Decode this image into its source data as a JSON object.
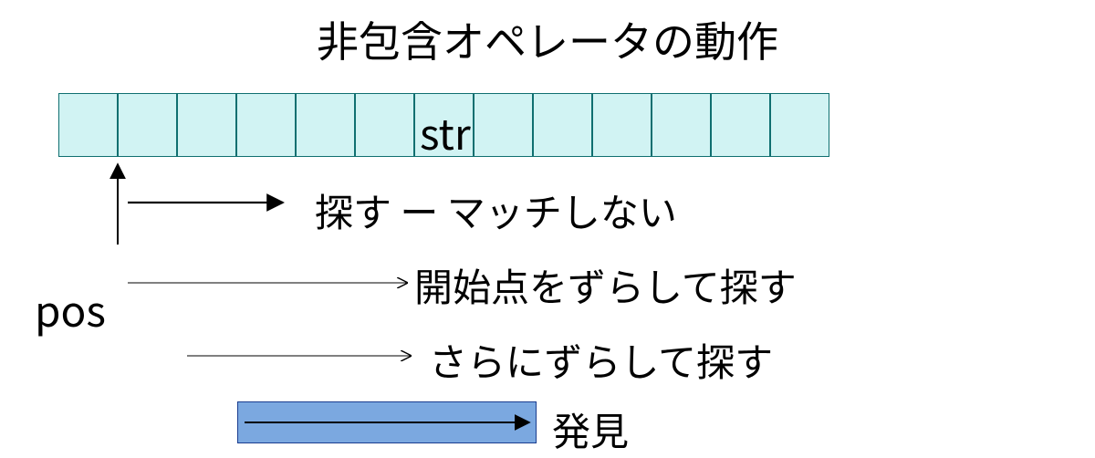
{
  "title": "非包含オペレータの動作",
  "array_label": "str",
  "pointer_label": "pos",
  "steps": {
    "search_nomatch": "探す ー マッチしない",
    "shift_search": "開始点をずらして探す",
    "further_shift": "さらにずらして探す",
    "found": "発見"
  },
  "cell_count": 13,
  "colors": {
    "cell_fill": "#d1f3f3",
    "cell_border": "#0f6f70",
    "found_fill": "#7ba8e0",
    "found_border": "#1a3d8f"
  }
}
